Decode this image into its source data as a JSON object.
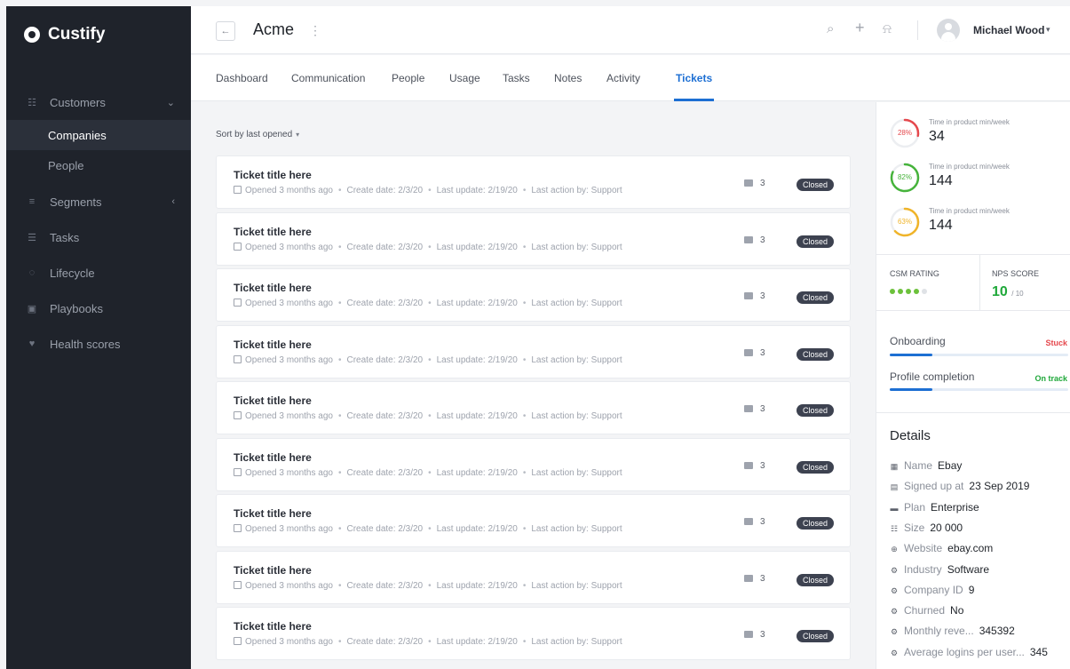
{
  "app": {
    "name": "Custify"
  },
  "sidebar": {
    "items": [
      {
        "label": "Customers",
        "icon": "users-icon",
        "glyph": "☷",
        "chevron": "⌄"
      },
      {
        "label": "Segments",
        "icon": "segments-icon",
        "glyph": "≡",
        "chevron": "‹"
      },
      {
        "label": "Tasks",
        "icon": "tasks-icon",
        "glyph": "☰"
      },
      {
        "label": "Lifecycle",
        "icon": "lifecycle-icon",
        "glyph": "◌"
      },
      {
        "label": "Playbooks",
        "icon": "playbooks-icon",
        "glyph": "▣"
      },
      {
        "label": "Health scores",
        "icon": "heart-icon",
        "glyph": "♥"
      }
    ],
    "subitems": [
      "Companies",
      "People"
    ],
    "active_subitem": "Companies"
  },
  "header": {
    "back_glyph": "←",
    "title": "Acme",
    "menu_glyph": "⋮",
    "search_glyph": "⌕",
    "add_glyph": "+",
    "bell_glyph": "⍾",
    "user_name": "Michael Wood",
    "user_caret": "▾"
  },
  "tabs": [
    "Dashboard",
    "Communication",
    "People",
    "Usage",
    "Tasks",
    "Notes",
    "Activity",
    "Tickets"
  ],
  "active_tab": "Tickets",
  "sort": {
    "label": "Sort by last opened",
    "caret": "▾"
  },
  "tickets": [
    {
      "title": "Ticket title here",
      "opened": "Opened 3 months ago",
      "create": "Create date: 2/3/20",
      "update": "Last update: 2/19/20",
      "action": "Last action by: Support",
      "comments": "3",
      "status": "Closed"
    },
    {
      "title": "Ticket title here",
      "opened": "Opened 3 months ago",
      "create": "Create date: 2/3/20",
      "update": "Last update: 2/19/20",
      "action": "Last action by: Support",
      "comments": "3",
      "status": "Closed"
    },
    {
      "title": "Ticket title here",
      "opened": "Opened 3 months ago",
      "create": "Create date: 2/3/20",
      "update": "Last update: 2/19/20",
      "action": "Last action by: Support",
      "comments": "3",
      "status": "Closed"
    },
    {
      "title": "Ticket title here",
      "opened": "Opened 3 months ago",
      "create": "Create date: 2/3/20",
      "update": "Last update: 2/19/20",
      "action": "Last action by: Support",
      "comments": "3",
      "status": "Closed"
    },
    {
      "title": "Ticket title here",
      "opened": "Opened 3 months ago",
      "create": "Create date: 2/3/20",
      "update": "Last update: 2/19/20",
      "action": "Last action by: Support",
      "comments": "3",
      "status": "Closed"
    },
    {
      "title": "Ticket title here",
      "opened": "Opened 3 months ago",
      "create": "Create date: 2/3/20",
      "update": "Last update: 2/19/20",
      "action": "Last action by: Support",
      "comments": "3",
      "status": "Closed"
    },
    {
      "title": "Ticket title here",
      "opened": "Opened 3 months ago",
      "create": "Create date: 2/3/20",
      "update": "Last update: 2/19/20",
      "action": "Last action by: Support",
      "comments": "3",
      "status": "Closed"
    },
    {
      "title": "Ticket title here",
      "opened": "Opened 3 months ago",
      "create": "Create date: 2/3/20",
      "update": "Last update: 2/19/20",
      "action": "Last action by: Support",
      "comments": "3",
      "status": "Closed"
    },
    {
      "title": "Ticket title here",
      "opened": "Opened 3 months ago",
      "create": "Create date: 2/3/20",
      "update": "Last update: 2/19/20",
      "action": "Last action by: Support",
      "comments": "3",
      "status": "Closed"
    }
  ],
  "metrics": [
    {
      "percent": 28,
      "percent_label": "28%",
      "label": "Time in product min/week",
      "value": "34",
      "color": "#e5484d"
    },
    {
      "percent": 82,
      "percent_label": "82%",
      "label": "Time in product min/week",
      "value": "144",
      "color": "#46b33b"
    },
    {
      "percent": 63,
      "percent_label": "63%",
      "label": "Time in product min/week",
      "value": "144",
      "color": "#f0b429"
    }
  ],
  "csm": {
    "label": "CSM RATING",
    "rating": 4,
    "max": 5,
    "dot_color": "#6cc13b",
    "dot_empty": "#dfe2e6"
  },
  "nps": {
    "label": "NPS SCORE",
    "value": "10",
    "out_of": "/ 10",
    "color": "#1fa83a"
  },
  "progress": [
    {
      "label": "Onboarding",
      "status": "Stuck",
      "status_color": "#e5484d",
      "percent": 24
    },
    {
      "label": "Profile completion",
      "status": "On track",
      "status_color": "#1fa83a",
      "percent": 24
    }
  ],
  "details": {
    "title": "Details",
    "rows": [
      {
        "label": "Name",
        "value": "Ebay",
        "icon": "building-icon",
        "glyph": "▦"
      },
      {
        "label": "Signed up at",
        "value": "23 Sep 2019",
        "icon": "calendar-icon",
        "glyph": "▤"
      },
      {
        "label": "Plan",
        "value": "Enterprise",
        "icon": "briefcase-icon",
        "glyph": "▬"
      },
      {
        "label": "Size",
        "value": "20 000",
        "icon": "users-icon",
        "glyph": "☷"
      },
      {
        "label": "Website",
        "value": "ebay.com",
        "icon": "globe-icon",
        "glyph": "⊕"
      },
      {
        "label": "Industry",
        "value": "Software",
        "icon": "gears-icon",
        "glyph": "⚙"
      },
      {
        "label": "Company ID",
        "value": "9",
        "icon": "gears-icon",
        "glyph": "⚙"
      },
      {
        "label": "Churned",
        "value": "No",
        "icon": "gears-icon",
        "glyph": "⚙"
      },
      {
        "label": "Monthly reve...",
        "value": "345392",
        "icon": "gears-icon",
        "glyph": "⚙"
      },
      {
        "label": "Average logins per user...",
        "value": "345",
        "icon": "gears-icon",
        "glyph": "⚙"
      }
    ]
  }
}
